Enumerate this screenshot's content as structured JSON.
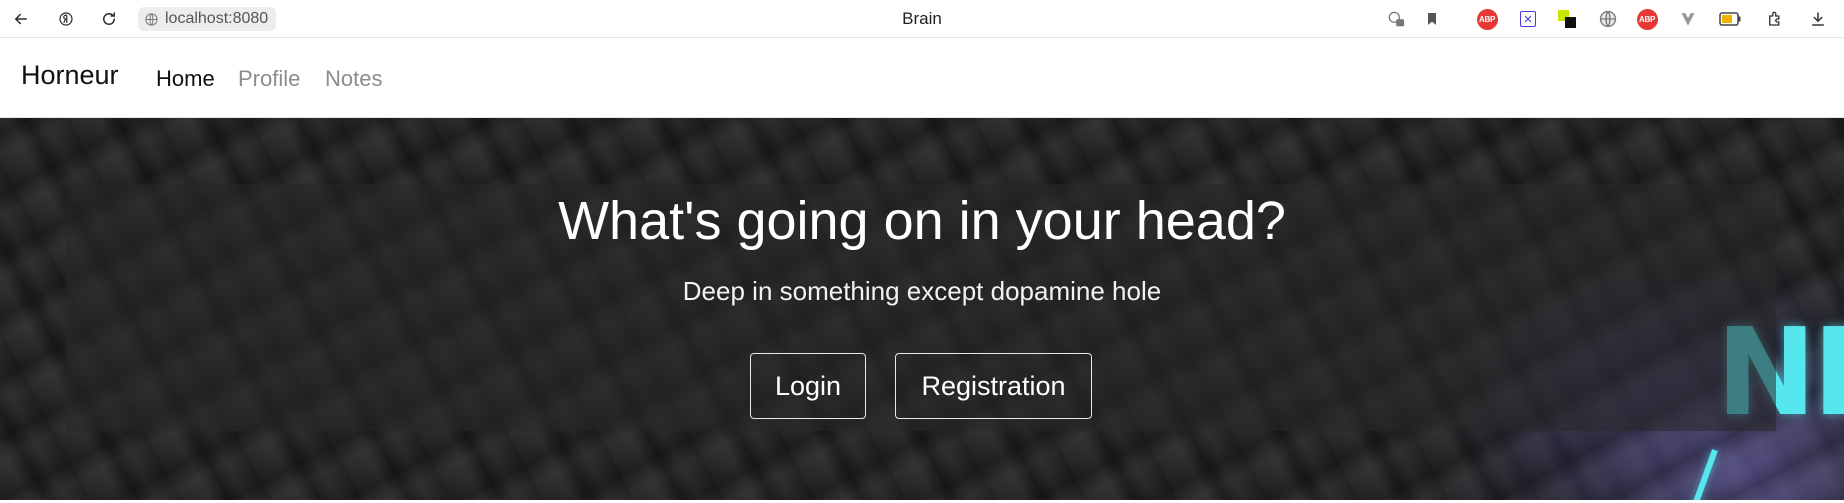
{
  "browser": {
    "url": "localhost:8080",
    "window_title": "Brain",
    "icons": [
      "back-icon",
      "yandex-icon",
      "reload-icon",
      "globe-icon"
    ],
    "extension_icons": [
      "password-icon",
      "bookmark-icon",
      "adblock-icon",
      "x-extension-icon",
      "color-extension-icon",
      "vpn-globe-icon",
      "adblock-icon",
      "vivaldi-icon",
      "battery-icon",
      "extensions-icon",
      "sidebar-icon",
      "download-icon"
    ],
    "abp_label": "ABP"
  },
  "navbar": {
    "brand": "Horneur",
    "links": [
      {
        "label": "Home",
        "active": true
      },
      {
        "label": "Profile",
        "active": false
      },
      {
        "label": "Notes",
        "active": false
      }
    ]
  },
  "hero": {
    "title": "What's going on in your head?",
    "subtitle": "Deep in something except dopamine hole",
    "buttons": {
      "login": "Login",
      "registration": "Registration"
    },
    "neon_text": "NH"
  },
  "colors": {
    "hero_background": "#222222",
    "neon": "#55e6ee",
    "abp_red": "#e53935",
    "muted_link": "#8c8c8c"
  }
}
